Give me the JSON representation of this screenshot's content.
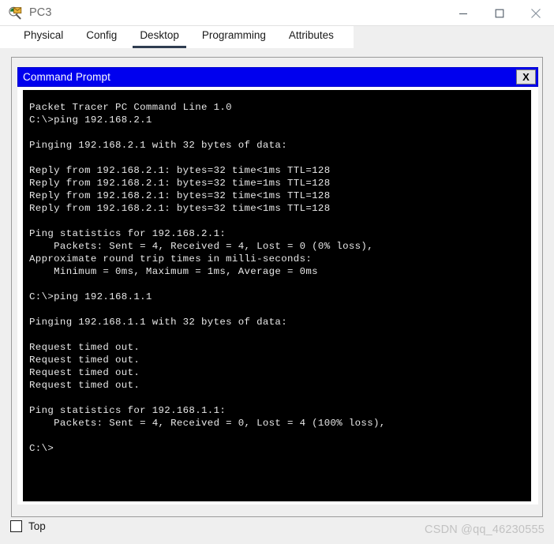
{
  "window": {
    "title": "PC3",
    "icon": "packet-tracer-pc-icon",
    "controls": {
      "minimize_label": "—",
      "maximize_label": "□",
      "close_label": "✕"
    }
  },
  "tabs": [
    {
      "label": "Physical",
      "active": false
    },
    {
      "label": "Config",
      "active": false
    },
    {
      "label": "Desktop",
      "active": true
    },
    {
      "label": "Programming",
      "active": false
    },
    {
      "label": "Attributes",
      "active": false
    }
  ],
  "cmd_window": {
    "title": "Command Prompt",
    "close_label": "X",
    "title_bg": "#0000ee",
    "title_fg": "#ffffff"
  },
  "terminal": {
    "bg": "#000000",
    "fg": "#e8e8e8",
    "text": "Packet Tracer PC Command Line 1.0\nC:\\>ping 192.168.2.1\n\nPinging 192.168.2.1 with 32 bytes of data:\n\nReply from 192.168.2.1: bytes=32 time<1ms TTL=128\nReply from 192.168.2.1: bytes=32 time=1ms TTL=128\nReply from 192.168.2.1: bytes=32 time<1ms TTL=128\nReply from 192.168.2.1: bytes=32 time<1ms TTL=128\n\nPing statistics for 192.168.2.1:\n    Packets: Sent = 4, Received = 4, Lost = 0 (0% loss),\nApproximate round trip times in milli-seconds:\n    Minimum = 0ms, Maximum = 1ms, Average = 0ms\n\nC:\\>ping 192.168.1.1\n\nPinging 192.168.1.1 with 32 bytes of data:\n\nRequest timed out.\nRequest timed out.\nRequest timed out.\nRequest timed out.\n\nPing statistics for 192.168.1.1:\n    Packets: Sent = 4, Received = 0, Lost = 4 (100% loss),\n\nC:\\>"
  },
  "bottom": {
    "top_checkbox_label": "Top",
    "top_checkbox_checked": false,
    "watermark": "CSDN @qq_46230555"
  }
}
